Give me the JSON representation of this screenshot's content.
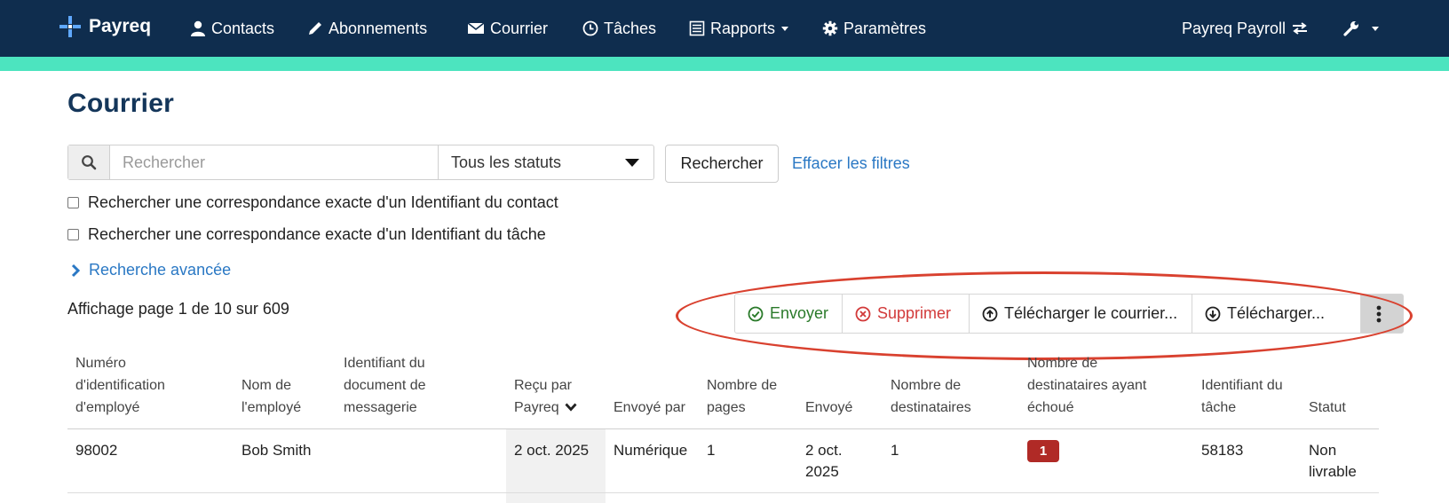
{
  "navbar": {
    "brand": "Payreq",
    "items": [
      {
        "label": "Contacts",
        "icon": "user-icon"
      },
      {
        "label": "Abonnements",
        "icon": "pencil-icon"
      },
      {
        "label": "Courrier",
        "icon": "envelope-icon"
      },
      {
        "label": "Tâches",
        "icon": "clock-icon"
      },
      {
        "label": "Rapports",
        "icon": "report-icon"
      },
      {
        "label": "Paramètres",
        "icon": "gear-icon"
      }
    ],
    "account": "Payreq Payroll",
    "colors": {
      "background": "#0f2d4e",
      "accent": "#4ce4bf"
    }
  },
  "page": {
    "title": "Courrier"
  },
  "search": {
    "placeholder": "Rechercher",
    "value": "",
    "status_selected": "Tous les statuts",
    "submit_label": "Rechercher",
    "clear_label": "Effacer les filtres",
    "exact_contact_label": "Rechercher une correspondance exacte d'un Identifiant du contact",
    "exact_task_label": "Rechercher une correspondance exacte d'un Identifiant du tâche",
    "advanced_label": "Recherche avancée"
  },
  "paging": {
    "info": "Affichage page 1 de 10 sur 609"
  },
  "actions": {
    "send": "Envoyer",
    "delete": "Supprimer",
    "upload": "Télécharger le courrier...",
    "download": "Télécharger...",
    "colors": {
      "send": "#2a7a2a",
      "delete": "#d23a3a",
      "highlight": "#d9412f"
    }
  },
  "table": {
    "columns": {
      "employee_id": "Numéro d'identification d'employé",
      "employee_name": "Nom de l'employé",
      "document_id": "Identifiant du document de messagerie",
      "received": "Reçu par Payreq",
      "sent_by": "Envoyé par",
      "pages": "Nombre de pages",
      "sent": "Envoyé",
      "recipients": "Nombre de destinataires",
      "failed": "Nombre de destinataires ayant échoué",
      "task_id": "Identifiant du tâche",
      "status": "Statut"
    },
    "rows": [
      {
        "employee_id": "98002",
        "employee_name": "Bob Smith",
        "document_id": "",
        "received": "2 oct. 2025",
        "sent_by": "Numérique",
        "pages": "1",
        "sent": "2 oct. 2025",
        "recipients": "1",
        "failed": "1",
        "task_id": "58183",
        "status": "Non livrable"
      }
    ]
  }
}
